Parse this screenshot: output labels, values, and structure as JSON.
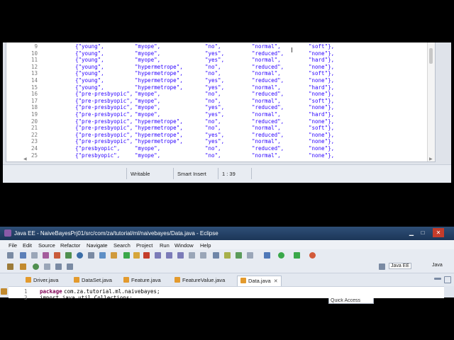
{
  "top_editor": {
    "lines": [
      {
        "num": "9",
        "age": "{\"young\",",
        "rx": "\"myope\",",
        "ast": "\"no\",",
        "tear": "\"normal\",",
        "lens": "\"soft\"},"
      },
      {
        "num": "10",
        "age": "{\"young\",",
        "rx": "\"myope\",",
        "ast": "\"yes\",",
        "tear": "\"reduced\",",
        "lens": "\"none\"},"
      },
      {
        "num": "11",
        "age": "{\"young\",",
        "rx": "\"myope\",",
        "ast": "\"yes\",",
        "tear": "\"normal\",",
        "lens": "\"hard\"},"
      },
      {
        "num": "12",
        "age": "{\"young\",",
        "rx": "\"hypermetrope\",",
        "ast": "\"no\",",
        "tear": "\"reduced\",",
        "lens": "\"none\"},"
      },
      {
        "num": "13",
        "age": "{\"young\",",
        "rx": "\"hypermetrope\",",
        "ast": "\"no\",",
        "tear": "\"normal\",",
        "lens": "\"soft\"},"
      },
      {
        "num": "14",
        "age": "{\"young\",",
        "rx": "\"hypermetrope\",",
        "ast": "\"yes\",",
        "tear": "\"reduced\",",
        "lens": "\"none\"},"
      },
      {
        "num": "15",
        "age": "{\"young\",",
        "rx": "\"hypermetrope\",",
        "ast": "\"yes\",",
        "tear": "\"normal\",",
        "lens": "\"hard\"},"
      },
      {
        "num": "16",
        "age": "{\"pre-presbyopic\",",
        "rx": "\"myope\",",
        "ast": "\"no\",",
        "tear": "\"reduced\",",
        "lens": "\"none\"},"
      },
      {
        "num": "17",
        "age": "{\"pre-presbyopic\",",
        "rx": "\"myope\",",
        "ast": "\"no\",",
        "tear": "\"normal\",",
        "lens": "\"soft\"},"
      },
      {
        "num": "18",
        "age": "{\"pre-presbyopic\",",
        "rx": "\"myope\",",
        "ast": "\"yes\",",
        "tear": "\"reduced\",",
        "lens": "\"none\"},"
      },
      {
        "num": "19",
        "age": "{\"pre-presbyopic\",",
        "rx": "\"myope\",",
        "ast": "\"yes\",",
        "tear": "\"normal\",",
        "lens": "\"hard\"},"
      },
      {
        "num": "20",
        "age": "{\"pre-presbyopic\",",
        "rx": "\"hypermetrope\",",
        "ast": "\"no\",",
        "tear": "\"reduced\",",
        "lens": "\"none\"},"
      },
      {
        "num": "21",
        "age": "{\"pre-presbyopic\",",
        "rx": "\"hypermetrope\",",
        "ast": "\"no\",",
        "tear": "\"normal\",",
        "lens": "\"soft\"},"
      },
      {
        "num": "22",
        "age": "{\"pre-presbyopic\",",
        "rx": "\"hypermetrope\",",
        "ast": "\"yes\",",
        "tear": "\"reduced\",",
        "lens": "\"none\"},"
      },
      {
        "num": "23",
        "age": "{\"pre-presbyopic\",",
        "rx": "\"hypermetrope\",",
        "ast": "\"yes\",",
        "tear": "\"normal\",",
        "lens": "\"none\"},"
      },
      {
        "num": "24",
        "age": "{\"presbyopic\",",
        "rx": "\"myope\",",
        "ast": "\"no\",",
        "tear": "\"reduced\",",
        "lens": "\"none\"},"
      },
      {
        "num": "25",
        "age": "{\"presbyopic\",",
        "rx": "\"myope\",",
        "ast": "\"no\",",
        "tear": "\"normal\",",
        "lens": "\"none\"},"
      }
    ],
    "status": {
      "writable": "Writable",
      "insert_mode": "Smart Insert",
      "position": "1 : 39"
    }
  },
  "bottom_window": {
    "title": "Java EE - NaiveBayesPrj01/src/com/za/tutorial/ml/naivebayes/Data.java - Eclipse",
    "menu": [
      "File",
      "Edit",
      "Source",
      "Refactor",
      "Navigate",
      "Search",
      "Project",
      "Run",
      "Window",
      "Help"
    ],
    "quick_access_placeholder": "Quick Access",
    "perspectives": [
      "Java EE",
      "Java"
    ],
    "tabs": [
      {
        "label": "Driver.java"
      },
      {
        "label": "DataSet.java"
      },
      {
        "label": "Feature.java"
      },
      {
        "label": "FeatureValue.java"
      },
      {
        "label": "Data.java",
        "active": true
      }
    ],
    "code": {
      "line1_num": "1",
      "line1_keyword": "package",
      "line1_rest": " com.za.tutorial.ml.naivebayes;",
      "line2_num": "3",
      "line2_text": "import java.util.Collections;"
    }
  }
}
